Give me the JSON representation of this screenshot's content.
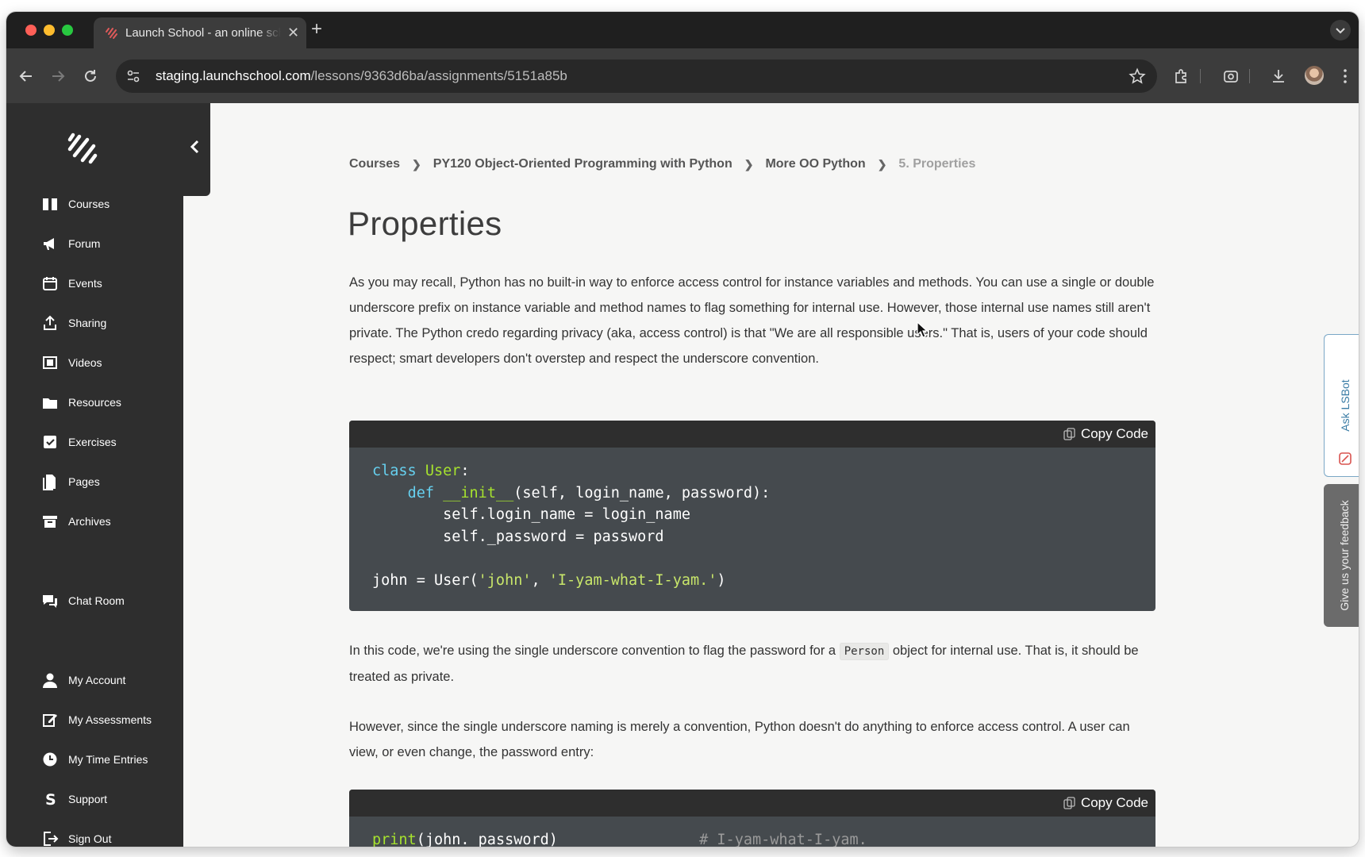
{
  "browser": {
    "tab_title": "Launch School - an online school for Software Engineers",
    "url_host": "staging.launchschool.com",
    "url_path": "/lessons/9363d6ba/assignments/5151a85b"
  },
  "sidebar": {
    "items": [
      {
        "label": "Courses",
        "icon": "book-icon"
      },
      {
        "label": "Forum",
        "icon": "megaphone-icon"
      },
      {
        "label": "Events",
        "icon": "calendar-icon"
      },
      {
        "label": "Sharing",
        "icon": "share-upload-icon"
      },
      {
        "label": "Videos",
        "icon": "film-icon"
      },
      {
        "label": "Resources",
        "icon": "folder-icon"
      },
      {
        "label": "Exercises",
        "icon": "checkbox-icon"
      },
      {
        "label": "Pages",
        "icon": "pages-icon"
      },
      {
        "label": "Archives",
        "icon": "archive-icon"
      },
      {
        "label": "Chat Room",
        "icon": "chat-icon"
      },
      {
        "label": "My Account",
        "icon": "user-icon"
      },
      {
        "label": "My Assessments",
        "icon": "edit-icon"
      },
      {
        "label": "My Time Entries",
        "icon": "clock-icon"
      },
      {
        "label": "Support",
        "icon": "support-s-icon"
      },
      {
        "label": "Sign Out",
        "icon": "sign-out-icon"
      }
    ]
  },
  "breadcrumb": [
    "Courses",
    "PY120 Object-Oriented Programming with Python",
    "More OO Python",
    "5. Properties"
  ],
  "page_title": "Properties",
  "paragraphs": {
    "p1": "As you may recall, Python has no built-in way to enforce access control for instance variables and methods. You can use a single or double underscore prefix on instance variable and method names to flag something for internal use. However, those internal use names still aren't private. The Python credo regarding privacy (aka, access control) is that \"We are all responsible users.\" That is, users of your code should respect; smart developers don't overstep and respect the underscore convention.",
    "p2_before": "In this code, we're using the single underscore convention to flag the password for a",
    "p2_code": "Person",
    "p2_after": "object for internal use. That is, it should be treated as private.",
    "p3": "However, since the single underscore naming is merely a convention, Python doesn't do anything to enforce access control. A user can view, or even change, the password entry:"
  },
  "code": {
    "copy_label": "Copy Code",
    "block1": [
      [
        {
          "t": "class",
          "c": "kw"
        },
        {
          "t": " "
        },
        {
          "t": "User",
          "c": "cls"
        },
        {
          "t": ":"
        }
      ],
      [
        {
          "t": "    "
        },
        {
          "t": "def",
          "c": "kw"
        },
        {
          "t": " "
        },
        {
          "t": "__init__",
          "c": "cls"
        },
        {
          "t": "(self, login_name, password):"
        }
      ],
      [
        {
          "t": "        self.login_name = login_name"
        }
      ],
      [
        {
          "t": "        self._password = password"
        }
      ],
      [
        {
          "t": ""
        }
      ],
      [
        {
          "t": "john = User("
        },
        {
          "t": "'john'",
          "c": "str"
        },
        {
          "t": ", "
        },
        {
          "t": "'I-yam-what-I-yam.'",
          "c": "str"
        },
        {
          "t": ")"
        }
      ]
    ],
    "block2": [
      [
        {
          "t": "print",
          "c": "cls"
        },
        {
          "t": "(john._password)"
        },
        {
          "t": "                "
        },
        {
          "t": "# I-yam-what-I-yam.",
          "c": "cmt"
        }
      ]
    ]
  },
  "side_tabs": {
    "ask": "Ask LSBot",
    "feedback": "Give us your feedback"
  }
}
